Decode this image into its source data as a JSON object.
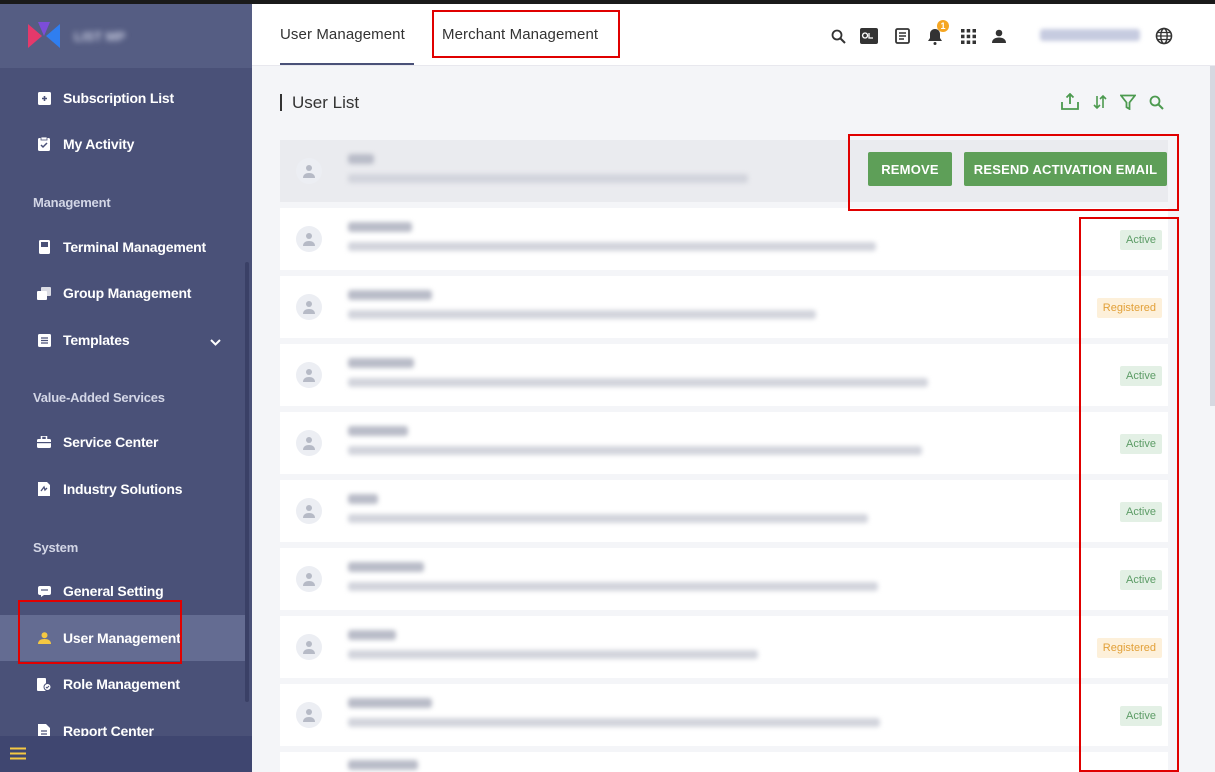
{
  "sidebar": {
    "items": [
      {
        "label": "Subscription List",
        "icon": "subscription-icon"
      },
      {
        "label": "My Activity",
        "icon": "activity-icon"
      },
      {
        "label": "Terminal Management",
        "icon": "terminal-icon"
      },
      {
        "label": "Group Management",
        "icon": "group-icon"
      },
      {
        "label": "Templates",
        "icon": "templates-icon"
      },
      {
        "label": "Service Center",
        "icon": "service-icon"
      },
      {
        "label": "Industry Solutions",
        "icon": "industry-icon"
      },
      {
        "label": "General Setting",
        "icon": "setting-icon"
      },
      {
        "label": "User Management",
        "icon": "user-icon"
      },
      {
        "label": "Role Management",
        "icon": "role-icon"
      },
      {
        "label": "Report Center",
        "icon": "report-icon"
      }
    ],
    "sections": {
      "management": "Management",
      "value_added": "Value-Added Services",
      "system": "System"
    }
  },
  "header": {
    "tabs": [
      {
        "label": "User Management"
      },
      {
        "label": "Merchant Management"
      }
    ],
    "notification_count": "1"
  },
  "main": {
    "title": "User List",
    "actions": {
      "remove": "REMOVE",
      "resend": "RESEND ACTIVATION EMAIL"
    },
    "rows": [
      {
        "status": ""
      },
      {
        "status": "Active"
      },
      {
        "status": "Registered"
      },
      {
        "status": "Active"
      },
      {
        "status": "Active"
      },
      {
        "status": "Active"
      },
      {
        "status": "Active"
      },
      {
        "status": "Registered"
      },
      {
        "status": "Active"
      }
    ]
  },
  "colors": {
    "sidebar": "#4a5178",
    "primary_button": "#5e9f58",
    "highlight": "#e00000"
  }
}
